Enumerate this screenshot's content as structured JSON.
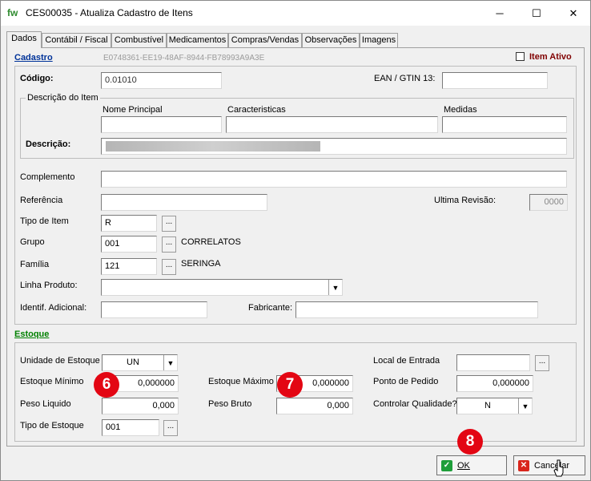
{
  "window": {
    "logo": "fw",
    "title": "CES00035 - Atualiza Cadastro de Itens",
    "minimize": "─",
    "maximize": "☐",
    "close": "✕"
  },
  "tabs": [
    "Dados",
    "Contábil / Fiscal",
    "Combustível",
    "Medicamentos",
    "Compras/Vendas",
    "Observações",
    "Imagens"
  ],
  "cadastro": {
    "title": "Cadastro",
    "guid": "E0748361-EE19-48AF-8944-FB78993A9A3E",
    "item_ativo_label": "Item Ativo",
    "codigo_label": "Código:",
    "codigo_value": "0.01010",
    "ean_label": "EAN / GTIN 13:",
    "ean_value": "",
    "descricao_group": "Descrição do Item",
    "nome_principal_label": "Nome Principal",
    "caracteristicas_label": "Caracteristicas",
    "medidas_label": "Medidas",
    "descricao_label": "Descrição:",
    "complemento_label": "Complemento",
    "referencia_label": "Referência",
    "ultima_revisao_label": "Ultima Revisão:",
    "ultima_revisao_value": "0000",
    "tipo_item_label": "Tipo de Item",
    "tipo_item_value": "R",
    "grupo_label": "Grupo",
    "grupo_value": "001",
    "grupo_desc": "CORRELATOS",
    "familia_label": "Família",
    "familia_value": "121",
    "familia_desc": "SERINGA",
    "linha_label": "Linha Produto:",
    "identif_label": "Identif. Adicional:",
    "fabricante_label": "Fabricante:",
    "lookup": "..."
  },
  "estoque": {
    "title": "Estoque",
    "unidade_label": "Unidade de Estoque",
    "unidade_value": "UN",
    "local_label": "Local de Entrada",
    "estoque_min_label": "Estoque Mínimo",
    "estoque_min_value": "0,000000",
    "estoque_max_label": "Estoque Máximo",
    "estoque_max_value": "0,000000",
    "ponto_label": "Ponto de Pedido",
    "ponto_value": "0,000000",
    "peso_liq_label": "Peso Liquido",
    "peso_liq_value": "0,000",
    "peso_bruto_label": "Peso Bruto",
    "peso_bruto_value": "0,000",
    "controlar_label": "Controlar Qualidade?",
    "controlar_value": "N",
    "tipo_estoque_label": "Tipo de Estoque",
    "tipo_estoque_value": "001"
  },
  "badges": {
    "b6": "6",
    "b7": "7",
    "b8": "8"
  },
  "buttons": {
    "ok": "OK",
    "cancel": "Cancelar"
  },
  "colors": {
    "badge": "#e30613",
    "section": "#003399",
    "estoque_section": "#008000",
    "item_ativo": "#800000"
  }
}
